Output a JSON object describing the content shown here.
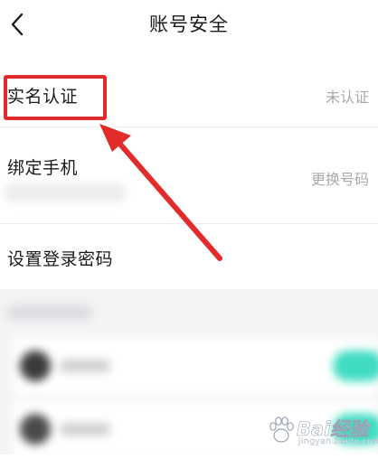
{
  "header": {
    "title": "账号安全",
    "back_icon": "chevron-left-icon"
  },
  "rows": [
    {
      "label": "实名认证",
      "value": "未认证"
    },
    {
      "label": "绑定手机",
      "value": "更换号码"
    },
    {
      "label": "设置登录密码",
      "value": ""
    }
  ],
  "watermark": {
    "text": "Bai经验",
    "sub": "jingyan.baidu.com"
  },
  "colors": {
    "annotation": "#e22b2b",
    "accent": "#3fdcc2",
    "muted_text": "#a8a8a8"
  }
}
